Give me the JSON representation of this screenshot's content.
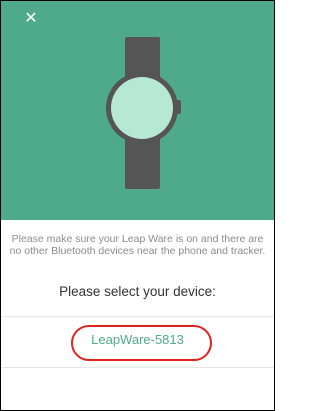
{
  "header": {
    "close_icon": "close-icon",
    "illustration": "smartwatch-illustration",
    "background_color": "#4faa8c"
  },
  "info": {
    "message": "Please make sure your Leap Ware is on and there are no other Bluetooth devices near the phone and tracker."
  },
  "device_selection": {
    "prompt": "Please select your device:",
    "devices": [
      {
        "name": "LeapWare-5813",
        "highlighted": true
      }
    ],
    "accent_color": "#4faa8c",
    "highlight_color": "#e0231e"
  }
}
